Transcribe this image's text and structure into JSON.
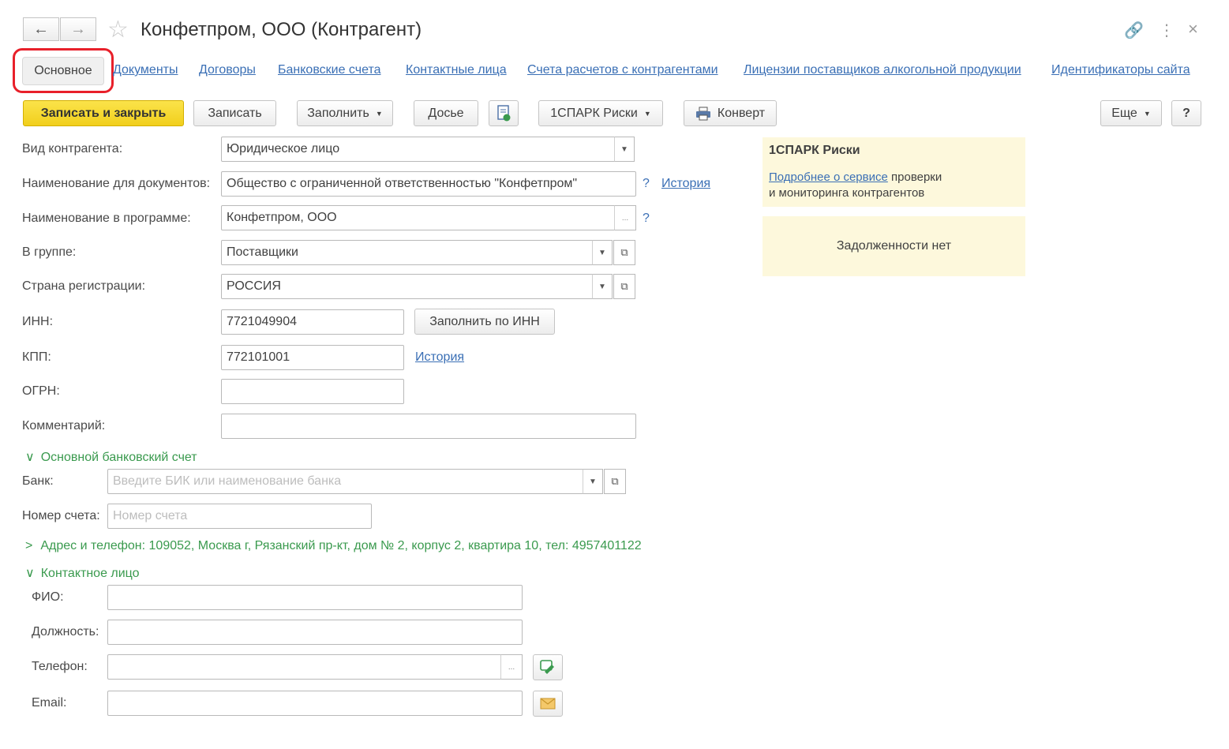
{
  "window": {
    "title": "Конфетпром, ООО (Контрагент)",
    "back_icon": "←",
    "forward_icon": "→",
    "star_icon": "☆",
    "link_icon": "🔗",
    "more_icon": "⋮",
    "close_icon": "×"
  },
  "tabs": [
    {
      "label": "Основное",
      "active": true
    },
    {
      "label": "Документы"
    },
    {
      "label": "Договоры"
    },
    {
      "label": "Банковские счета"
    },
    {
      "label": "Контактные лица"
    },
    {
      "label": "Счета расчетов с контрагентами"
    },
    {
      "label": "Лицензии поставщиков алкогольной продукции"
    },
    {
      "label": "Идентификаторы сайта"
    }
  ],
  "toolbar": {
    "save_close": "Записать и закрыть",
    "save": "Записать",
    "fill": "Заполнить",
    "dossier": "Досье",
    "spark": "1СПАРК Риски",
    "envelope": "Конверт",
    "more": "Еще",
    "help": "?"
  },
  "form": {
    "kind_label": "Вид контрагента:",
    "kind_value": "Юридическое лицо",
    "docname_label": "Наименование для документов:",
    "docname_value": "Общество с ограниченной ответственностью \"Конфетпром\"",
    "history_link": "История",
    "progname_label": "Наименование в программе:",
    "progname_value": "Конфетпром, ООО",
    "group_label": "В группе:",
    "group_value": "Поставщики",
    "country_label": "Страна регистрации:",
    "country_value": "РОССИЯ",
    "inn_label": "ИНН:",
    "inn_value": "7721049904",
    "fill_inn": "Заполнить по ИНН",
    "kpp_label": "КПП:",
    "kpp_value": "772101001",
    "kpp_history": "История",
    "ogrn_label": "ОГРН:",
    "ogrn_value": "",
    "comment_label": "Комментарий:",
    "comment_value": "",
    "help_mark": "?",
    "ellipsis": "..."
  },
  "bank": {
    "section_title": "Основной банковский счет",
    "bank_label": "Банк:",
    "bank_placeholder": "Введите БИК или наименование банка",
    "account_label": "Номер счета:",
    "account_placeholder": "Номер счета"
  },
  "address": {
    "section_title": "Адрес и телефон: 109052, Москва г, Рязанский пр-кт, дом № 2, корпус 2, квартира 10, тел: 4957401122"
  },
  "contact": {
    "section_title": "Контактное лицо",
    "fio_label": "ФИО:",
    "position_label": "Должность:",
    "phone_label": "Телефон:",
    "email_label": "Email:"
  },
  "spark_panel": {
    "title": "1СПАРК Риски",
    "link_text": "Подробнее о сервисе",
    "text_after_link": " проверки",
    "text_line2": "и мониторинга контрагентов",
    "debt_text": "Задолженности нет"
  },
  "colors": {
    "primary_button": "#f5d830",
    "link": "#3a6fb5",
    "section": "#3a9a4e",
    "highlight_ring": "#e8202a",
    "spark_bg": "#fdf8dc"
  }
}
